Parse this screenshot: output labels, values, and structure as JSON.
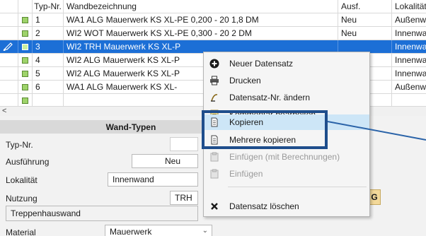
{
  "grid": {
    "headers": [
      "",
      "",
      "Typ-Nr.",
      "Wandbezeichnung",
      "Ausf.",
      "Lokalität"
    ],
    "rows": [
      {
        "nr": "1",
        "bez": "WA1 ALG Mauerwerk KS XL-PE 0,200 - 20 1,8 DM",
        "ausf": "Neu",
        "lok": "Außenwand"
      },
      {
        "nr": "2",
        "bez": "WI2 WOT Mauerwerk KS XL-PE 0,300 - 20 2 DM",
        "ausf": "Neu",
        "lok": "Innenwand"
      },
      {
        "nr": "3",
        "bez": "WI2 TRH Mauerwerk KS XL-P",
        "ausf": "",
        "lok": "Innenwand"
      },
      {
        "nr": "4",
        "bez": "WI2 ALG Mauerwerk KS XL-P",
        "ausf": "",
        "lok": "Innenwand"
      },
      {
        "nr": "5",
        "bez": "WI2 ALG Mauerwerk KS XL-P",
        "ausf": "",
        "lok": "Innenwand"
      },
      {
        "nr": "6",
        "bez": "WA1 ALG Mauerwerk KS XL-",
        "ausf": "",
        "lok": "Außenwand"
      }
    ],
    "scroll_left_glyph": "<"
  },
  "form": {
    "title": "Wand-Typen",
    "typnr_label": "Typ-Nr.",
    "ausfuehrung_label": "Ausführung",
    "ausfuehrung_value": "Neu",
    "lokalitaet_label": "Lokalität",
    "lokalitaet_value": "Innenwand",
    "nutzung_label": "Nutzung",
    "nutzung_value": "TRH",
    "nutzung_text": "Treppenhauswand",
    "material_label": "Material",
    "material_value": "Mauerwerk",
    "badge": "G"
  },
  "context_menu": {
    "items": [
      {
        "label": "Neuer Datensatz",
        "icon": "plus-circle-icon",
        "enabled": true
      },
      {
        "label": "Drucken",
        "icon": "printer-icon",
        "enabled": true
      },
      {
        "label": "Datensatz-Nr. ändern",
        "icon": "renumber-icon",
        "enabled": true
      },
      {
        "label": "Kommentar bearbeiten",
        "icon": "note-icon",
        "enabled": true
      },
      {
        "label": "Kopieren",
        "icon": "copy-icon",
        "enabled": true
      },
      {
        "label": "Mehrere kopieren",
        "icon": "copy-multiple-icon",
        "enabled": true
      },
      {
        "label": "Einfügen (mit Berechnungen)",
        "icon": "paste-icon",
        "enabled": false
      },
      {
        "label": "Einfügen",
        "icon": "paste-icon",
        "enabled": false
      },
      {
        "label": "Datensatz löschen",
        "icon": "delete-icon",
        "enabled": true
      }
    ]
  },
  "colors": {
    "selection": "#1c6fd6",
    "highlight": "#cde6f7",
    "callout": "#1f4e8c",
    "status_green": "#9ed36a"
  }
}
